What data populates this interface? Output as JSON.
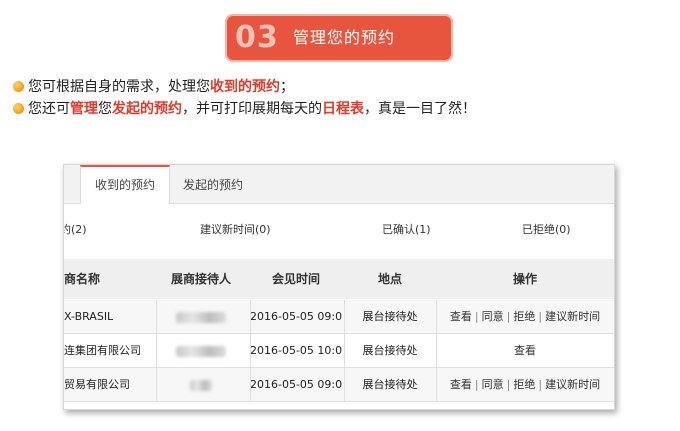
{
  "banner": {
    "number": "03",
    "title": "管理您的预约"
  },
  "intro": {
    "line1": [
      {
        "text": "您可根据自身的需求，处理您",
        "hl": false
      },
      {
        "text": "收到的预约",
        "hl": true
      },
      {
        "text": "；",
        "hl": false
      }
    ],
    "line2": [
      {
        "text": "您还可",
        "hl": false
      },
      {
        "text": "管理",
        "hl": true
      },
      {
        "text": "您",
        "hl": false
      },
      {
        "text": "发起的预约",
        "hl": true
      },
      {
        "text": "，并可打印展期每天的",
        "hl": false
      },
      {
        "text": "日程表",
        "hl": true
      },
      {
        "text": "，真是一目了然！",
        "hl": false
      }
    ]
  },
  "tabs": {
    "received": "收到的预约",
    "sent": "发起的预约"
  },
  "stats": {
    "pending": "约(2)",
    "suggest": "建议新时间(0)",
    "confirmed": "已确认(1)",
    "rejected": "已拒绝(0)"
  },
  "table": {
    "headers": {
      "company": "商名称",
      "contact": "展商接待人",
      "time": "会见时间",
      "place": "地点",
      "action": "操作"
    },
    "rows": [
      {
        "company": "X-BRASIL",
        "time": "2016-05-05  09:00",
        "place": "展台接待处",
        "actions": [
          "查看",
          "同意",
          "拒绝",
          "建议新时间"
        ]
      },
      {
        "company": "连集团有限公司",
        "time": "2016-05-05  10:00",
        "place": "展台接待处",
        "actions": [
          "查看"
        ]
      },
      {
        "company": "贸易有限公司",
        "time": "2016-05-05  09:00",
        "place": "展台接待处",
        "actions": [
          "查看",
          "同意",
          "拒绝",
          "建议新时间"
        ]
      }
    ]
  }
}
